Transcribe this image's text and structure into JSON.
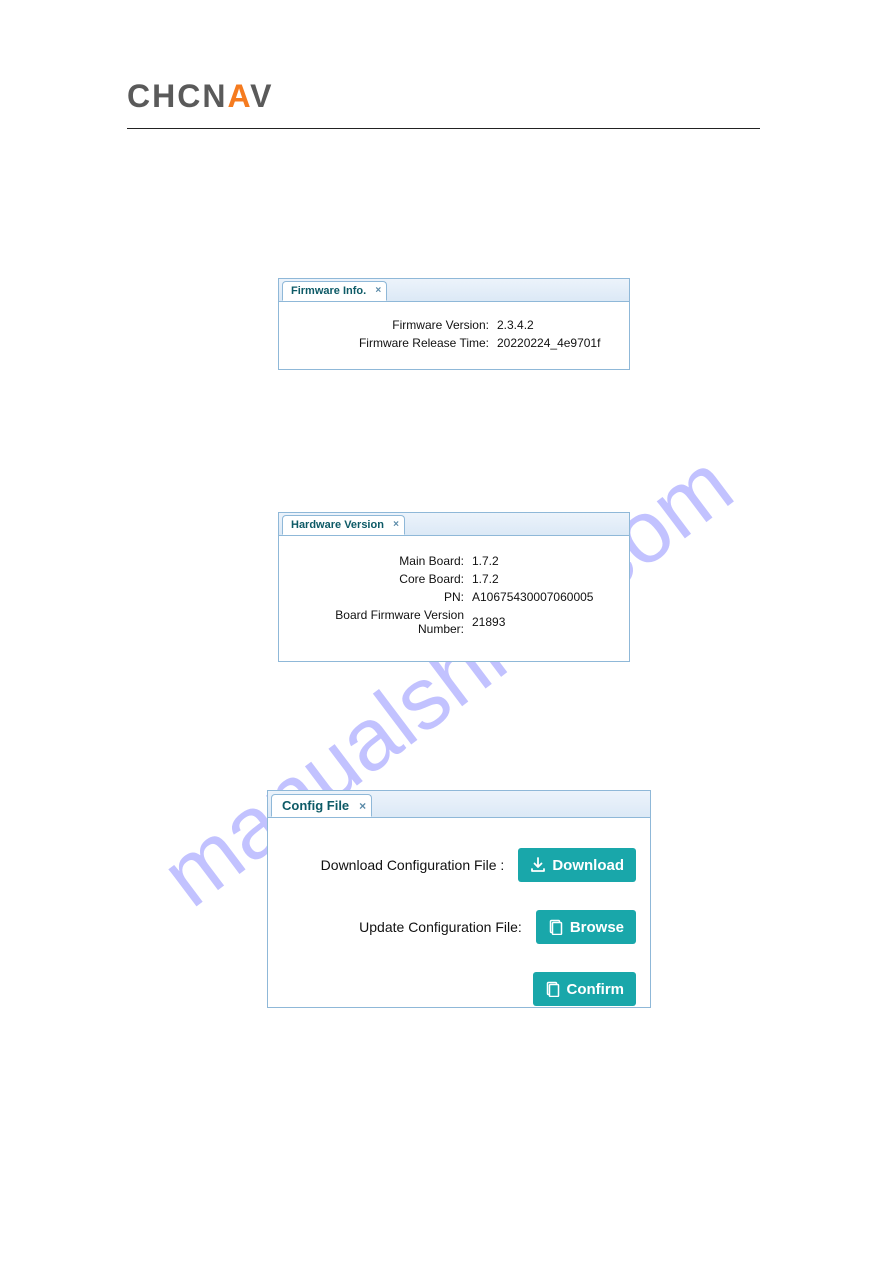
{
  "brand": {
    "text": "CHCNAV"
  },
  "watermark": "manualshive.com",
  "firmware_panel": {
    "tab_label": "Firmware Info.",
    "rows": [
      {
        "label": "Firmware Version:",
        "value": "2.3.4.2"
      },
      {
        "label": "Firmware Release Time:",
        "value": "20220224_4e9701f"
      }
    ]
  },
  "hardware_panel": {
    "tab_label": "Hardware Version",
    "rows": [
      {
        "label": "Main Board:",
        "value": "1.7.2"
      },
      {
        "label": "Core Board:",
        "value": "1.7.2"
      },
      {
        "label": "PN:",
        "value": "A10675430007060005"
      },
      {
        "label": "Board Firmware Version Number:",
        "value": "21893"
      }
    ]
  },
  "config_panel": {
    "tab_label": "Config File",
    "download_label": "Download Configuration File :",
    "update_label": "Update Configuration File:",
    "download_btn": "Download",
    "browse_btn": "Browse",
    "confirm_btn": "Confirm"
  }
}
